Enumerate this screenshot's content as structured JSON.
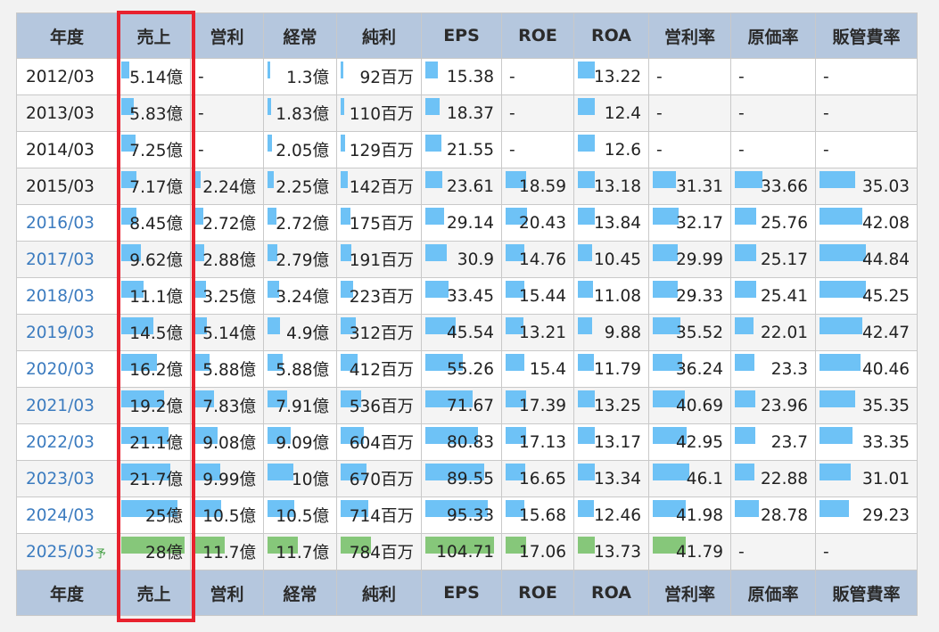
{
  "headers": [
    "年度",
    "売上",
    "営利",
    "経常",
    "純利",
    "EPS",
    "ROE",
    "ROA",
    "営利率",
    "原価率",
    "販管費率"
  ],
  "forecast_mark": "予",
  "colors": {
    "bar": "#6ec2f6",
    "forecast_bar": "#86c77a",
    "highlight": "#e8222e",
    "link": "#3b7bbf",
    "header_bg": "#b5c7de"
  },
  "rows": [
    {
      "year": "2012/03",
      "link": false,
      "forecast": false,
      "cells": [
        {
          "t": "5.14億",
          "f": 0.12
        },
        {
          "t": "-"
        },
        {
          "t": "1.3億",
          "f": 0.04
        },
        {
          "t": "92百万",
          "f": 0.03
        },
        {
          "t": "15.38",
          "f": 0.18
        },
        {
          "t": "-"
        },
        {
          "t": "13.22",
          "f": 0.25
        },
        {
          "t": "-"
        },
        {
          "t": "-"
        },
        {
          "t": "-"
        }
      ]
    },
    {
      "year": "2013/03",
      "link": false,
      "forecast": false,
      "cells": [
        {
          "t": "5.83億",
          "f": 0.2
        },
        {
          "t": "-"
        },
        {
          "t": "1.83億",
          "f": 0.06
        },
        {
          "t": "110百万",
          "f": 0.05
        },
        {
          "t": "18.37",
          "f": 0.2
        },
        {
          "t": "-"
        },
        {
          "t": "12.4",
          "f": 0.25
        },
        {
          "t": "-"
        },
        {
          "t": "-"
        },
        {
          "t": "-"
        }
      ]
    },
    {
      "year": "2014/03",
      "link": false,
      "forecast": false,
      "cells": [
        {
          "t": "7.25億",
          "f": 0.22
        },
        {
          "t": "-"
        },
        {
          "t": "2.05億",
          "f": 0.07
        },
        {
          "t": "129百万",
          "f": 0.06
        },
        {
          "t": "21.55",
          "f": 0.22
        },
        {
          "t": "-"
        },
        {
          "t": "12.6",
          "f": 0.25
        },
        {
          "t": "-"
        },
        {
          "t": "-"
        },
        {
          "t": "-"
        }
      ]
    },
    {
      "year": "2015/03",
      "link": false,
      "forecast": false,
      "cells": [
        {
          "t": "7.17億",
          "f": 0.24
        },
        {
          "t": "2.24億",
          "f": 0.1
        },
        {
          "t": "2.25億",
          "f": 0.1
        },
        {
          "t": "142百万",
          "f": 0.09
        },
        {
          "t": "23.61",
          "f": 0.24
        },
        {
          "t": "18.59",
          "f": 0.32
        },
        {
          "t": "13.18",
          "f": 0.25
        },
        {
          "t": "31.31",
          "f": 0.32
        },
        {
          "t": "33.66",
          "f": 0.36
        },
        {
          "t": "35.03",
          "f": 0.38
        }
      ]
    },
    {
      "year": "2016/03",
      "link": true,
      "forecast": false,
      "cells": [
        {
          "t": "8.45億",
          "f": 0.24
        },
        {
          "t": "2.72億",
          "f": 0.14
        },
        {
          "t": "2.72億",
          "f": 0.14
        },
        {
          "t": "175百万",
          "f": 0.13
        },
        {
          "t": "29.14",
          "f": 0.26
        },
        {
          "t": "20.43",
          "f": 0.34
        },
        {
          "t": "13.84",
          "f": 0.25
        },
        {
          "t": "32.17",
          "f": 0.35
        },
        {
          "t": "25.76",
          "f": 0.28
        },
        {
          "t": "42.08",
          "f": 0.46
        }
      ]
    },
    {
      "year": "2017/03",
      "link": true,
      "forecast": false,
      "cells": [
        {
          "t": "9.62億",
          "f": 0.3
        },
        {
          "t": "2.88億",
          "f": 0.15
        },
        {
          "t": "2.79億",
          "f": 0.15
        },
        {
          "t": "191百万",
          "f": 0.14
        },
        {
          "t": "30.9",
          "f": 0.3
        },
        {
          "t": "14.76",
          "f": 0.3
        },
        {
          "t": "10.45",
          "f": 0.22
        },
        {
          "t": "29.99",
          "f": 0.34
        },
        {
          "t": "25.17",
          "f": 0.28
        },
        {
          "t": "44.84",
          "f": 0.5
        }
      ]
    },
    {
      "year": "2018/03",
      "link": true,
      "forecast": false,
      "cells": [
        {
          "t": "11.1億",
          "f": 0.35
        },
        {
          "t": "3.25億",
          "f": 0.18
        },
        {
          "t": "3.24億",
          "f": 0.18
        },
        {
          "t": "223百万",
          "f": 0.16
        },
        {
          "t": "33.45",
          "f": 0.32
        },
        {
          "t": "15.44",
          "f": 0.3
        },
        {
          "t": "11.08",
          "f": 0.23
        },
        {
          "t": "29.33",
          "f": 0.34
        },
        {
          "t": "25.41",
          "f": 0.28
        },
        {
          "t": "45.25",
          "f": 0.5
        }
      ]
    },
    {
      "year": "2019/03",
      "link": true,
      "forecast": false,
      "cells": [
        {
          "t": "14.5億",
          "f": 0.5
        },
        {
          "t": "5.14億",
          "f": 0.2
        },
        {
          "t": "4.9億",
          "f": 0.2
        },
        {
          "t": "312百万",
          "f": 0.2
        },
        {
          "t": "45.54",
          "f": 0.42
        },
        {
          "t": "13.21",
          "f": 0.28
        },
        {
          "t": "9.88",
          "f": 0.21
        },
        {
          "t": "35.52",
          "f": 0.38
        },
        {
          "t": "22.01",
          "f": 0.25
        },
        {
          "t": "42.47",
          "f": 0.46
        }
      ]
    },
    {
      "year": "2020/03",
      "link": true,
      "forecast": false,
      "cells": [
        {
          "t": "16.2億",
          "f": 0.55
        },
        {
          "t": "5.88億",
          "f": 0.24
        },
        {
          "t": "5.88億",
          "f": 0.24
        },
        {
          "t": "412百万",
          "f": 0.22
        },
        {
          "t": "55.26",
          "f": 0.52
        },
        {
          "t": "15.4",
          "f": 0.3
        },
        {
          "t": "11.79",
          "f": 0.24
        },
        {
          "t": "36.24",
          "f": 0.4
        },
        {
          "t": "23.3",
          "f": 0.26
        },
        {
          "t": "40.46",
          "f": 0.44
        }
      ]
    },
    {
      "year": "2021/03",
      "link": true,
      "forecast": false,
      "cells": [
        {
          "t": "19.2億",
          "f": 0.66
        },
        {
          "t": "7.83億",
          "f": 0.3
        },
        {
          "t": "7.91億",
          "f": 0.3
        },
        {
          "t": "536百万",
          "f": 0.27
        },
        {
          "t": "71.67",
          "f": 0.66
        },
        {
          "t": "17.39",
          "f": 0.33
        },
        {
          "t": "13.25",
          "f": 0.25
        },
        {
          "t": "40.69",
          "f": 0.44
        },
        {
          "t": "23.96",
          "f": 0.27
        },
        {
          "t": "35.35",
          "f": 0.38
        }
      ]
    },
    {
      "year": "2022/03",
      "link": true,
      "forecast": false,
      "cells": [
        {
          "t": "21.1億",
          "f": 0.74
        },
        {
          "t": "9.08億",
          "f": 0.36
        },
        {
          "t": "9.09億",
          "f": 0.36
        },
        {
          "t": "604百万",
          "f": 0.3
        },
        {
          "t": "80.83",
          "f": 0.74
        },
        {
          "t": "17.13",
          "f": 0.32
        },
        {
          "t": "13.17",
          "f": 0.25
        },
        {
          "t": "42.95",
          "f": 0.46
        },
        {
          "t": "23.7",
          "f": 0.27
        },
        {
          "t": "33.35",
          "f": 0.36
        }
      ]
    },
    {
      "year": "2023/03",
      "link": true,
      "forecast": false,
      "cells": [
        {
          "t": "21.7億",
          "f": 0.76
        },
        {
          "t": "9.99億",
          "f": 0.4
        },
        {
          "t": "10億",
          "f": 0.4
        },
        {
          "t": "670百万",
          "f": 0.34
        },
        {
          "t": "89.55",
          "f": 0.82
        },
        {
          "t": "16.65",
          "f": 0.31
        },
        {
          "t": "13.34",
          "f": 0.25
        },
        {
          "t": "46.1",
          "f": 0.5
        },
        {
          "t": "22.88",
          "f": 0.26
        },
        {
          "t": "31.01",
          "f": 0.34
        }
      ]
    },
    {
      "year": "2024/03",
      "link": true,
      "forecast": false,
      "cells": [
        {
          "t": "25億",
          "f": 0.87
        },
        {
          "t": "10.5億",
          "f": 0.42
        },
        {
          "t": "10.5億",
          "f": 0.42
        },
        {
          "t": "714百万",
          "f": 0.36
        },
        {
          "t": "95.33",
          "f": 0.88
        },
        {
          "t": "15.68",
          "f": 0.3
        },
        {
          "t": "12.46",
          "f": 0.24
        },
        {
          "t": "41.98",
          "f": 0.45
        },
        {
          "t": "28.78",
          "f": 0.32
        },
        {
          "t": "29.23",
          "f": 0.32
        }
      ]
    },
    {
      "year": "2025/03",
      "link": true,
      "forecast": true,
      "cells": [
        {
          "t": "28億",
          "f": 0.98
        },
        {
          "t": "11.7億",
          "f": 0.47
        },
        {
          "t": "11.7億",
          "f": 0.47
        },
        {
          "t": "784百万",
          "f": 0.4
        },
        {
          "t": "104.71",
          "f": 0.96
        },
        {
          "t": "17.06",
          "f": 0.32
        },
        {
          "t": "13.73",
          "f": 0.26
        },
        {
          "t": "41.79",
          "f": 0.45
        },
        {
          "t": "-"
        },
        {
          "t": "-"
        }
      ]
    }
  ]
}
